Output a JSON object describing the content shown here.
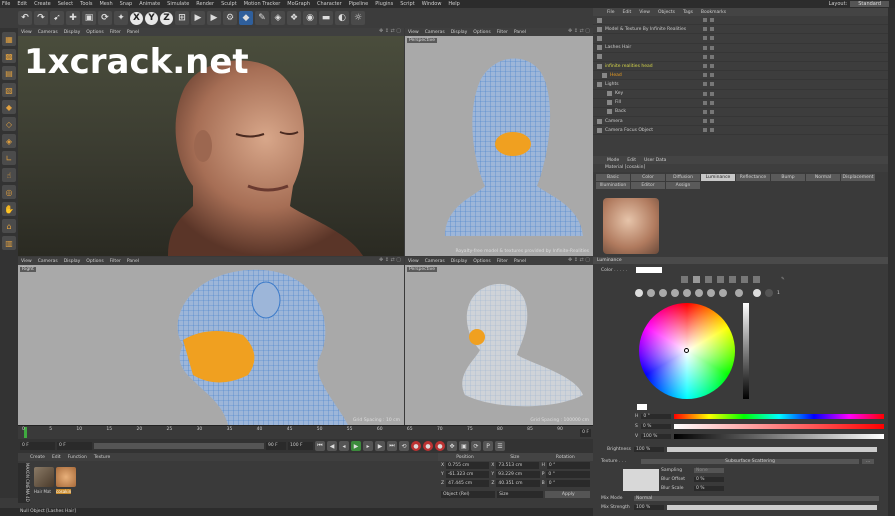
{
  "menu": [
    "File",
    "Edit",
    "Create",
    "Select",
    "Tools",
    "Mesh",
    "Snap",
    "Animate",
    "Simulate",
    "Render",
    "Sculpt",
    "Motion Tracker",
    "MoGraph",
    "Character",
    "Pipeline",
    "Plugins",
    "Script",
    "Window",
    "Help"
  ],
  "layout": {
    "label": "Layout:",
    "value": "Standard"
  },
  "watermark": "1xcrack.net",
  "viewport_menu": [
    "View",
    "Cameras",
    "Display",
    "Options",
    "Filter",
    "Panel"
  ],
  "viewports": [
    {
      "tag": "",
      "grid": ""
    },
    {
      "tag": "Perspective",
      "grid": "Royalty-free model & textures provided by Infinite-Realities"
    },
    {
      "tag": "Right",
      "grid": "Grid Spacing : 10 cm"
    },
    {
      "tag": "Perspective",
      "grid": "Grid Spacing : 100000 cm"
    }
  ],
  "timeline": {
    "ticks": [
      "0",
      "5",
      "10",
      "15",
      "20",
      "25",
      "30",
      "35",
      "40",
      "45",
      "50",
      "55",
      "60",
      "65",
      "70",
      "75",
      "80",
      "85",
      "90"
    ],
    "end": "0 F"
  },
  "transport": {
    "current": "0 F",
    "start": "0 F",
    "end": "90 F",
    "max": "100 F"
  },
  "materials": {
    "menu": [
      "Create",
      "Edit",
      "Function",
      "Texture"
    ],
    "items": [
      {
        "name": "Hair Mat",
        "color": "#6a5a48"
      },
      {
        "name": "cosakin",
        "color": "#c8905a"
      }
    ]
  },
  "coords": {
    "headers": [
      "Position",
      "Size",
      "Rotation"
    ],
    "rows": [
      {
        "a": "X",
        "pos": "0.755 cm",
        "s": "X",
        "size": "73.513 cm",
        "r": "H",
        "rot": "0 °"
      },
      {
        "a": "Y",
        "pos": "-61.323 cm",
        "s": "Y",
        "size": "93.229 cm",
        "r": "P",
        "rot": "0 °"
      },
      {
        "a": "Z",
        "pos": "47.445 cm",
        "s": "Z",
        "size": "40.351 cm",
        "r": "B",
        "rot": "0 °"
      }
    ],
    "mode": "Object (Rel)",
    "size_mode": "Size",
    "apply": "Apply"
  },
  "status": "Null Object [Lashes Hair]",
  "objmgr": {
    "menu": [
      "File",
      "Edit",
      "View",
      "Objects",
      "Tags",
      "Bookmarks"
    ],
    "rows": [
      {
        "name": "",
        "indent": 0,
        "color": "#ccc"
      },
      {
        "name": "Model & Texture By Infinite Realities",
        "indent": 0,
        "color": "#ccc"
      },
      {
        "name": "",
        "indent": 0,
        "color": "#ccc"
      },
      {
        "name": "Lashes Hair",
        "indent": 0,
        "color": "#ccc"
      },
      {
        "name": "",
        "indent": 0,
        "color": "#ccc"
      },
      {
        "name": "infinite realities head",
        "indent": 0,
        "color": "#d8d84a"
      },
      {
        "name": "Head",
        "indent": 1,
        "color": "#f0a020"
      },
      {
        "name": "Lights",
        "indent": 0,
        "color": "#ccc"
      },
      {
        "name": "Key",
        "indent": 2,
        "color": "#ccc"
      },
      {
        "name": "Fill",
        "indent": 2,
        "color": "#ccc"
      },
      {
        "name": "Back",
        "indent": 2,
        "color": "#ccc"
      },
      {
        "name": "Camera",
        "indent": 0,
        "color": "#ccc"
      },
      {
        "name": "Camera Focus Object",
        "indent": 0,
        "color": "#ccc"
      }
    ]
  },
  "attr": {
    "menu": [
      "Mode",
      "Edit",
      "User Data"
    ],
    "title": "Material [cosakin]",
    "tabs": [
      "Basic",
      "Color",
      "Diffusion",
      "Luminance",
      "Reflectance",
      "Bump",
      "Normal",
      "Displacement",
      "Illumination",
      "Editor",
      "Assign"
    ],
    "active_tab": "Luminance",
    "section": "Luminance",
    "color_label": "Color . . . . .",
    "hsv": [
      {
        "k": "H",
        "v": "0 °"
      },
      {
        "k": "S",
        "v": "0 %"
      },
      {
        "k": "V",
        "v": "100 %"
      }
    ],
    "brightness": {
      "label": "Brightness",
      "value": "100 %"
    },
    "texture": {
      "label": "Texture . . .",
      "value": "Subsurface Scattering"
    },
    "sampling": {
      "label": "Sampling",
      "value": "None"
    },
    "blur_offset": {
      "label": "Blur Offset",
      "value": "0 %"
    },
    "blur_scale": {
      "label": "Blur Scale",
      "value": "0 %"
    },
    "mix_mode": {
      "label": "Mix Mode",
      "value": "Normal"
    },
    "mix_strength": {
      "label": "Mix Strength",
      "value": "100 %"
    },
    "one": "1"
  }
}
